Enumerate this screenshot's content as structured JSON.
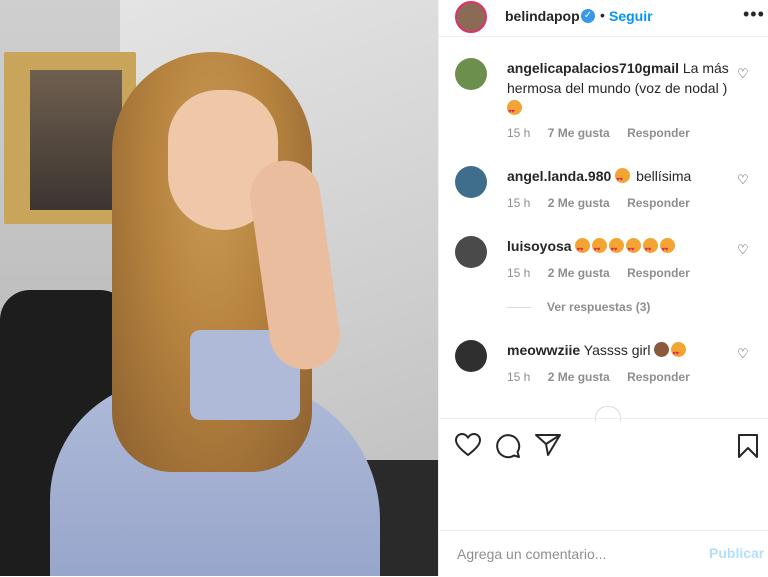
{
  "post": {
    "username": "belindapop",
    "follow_label": "Seguir",
    "dot": "•",
    "more_label": "•••"
  },
  "comments": [
    {
      "username": "angelicapalacios710gmail",
      "text": "La más hermosa del mundo (voz de nodal )",
      "emojis": 1,
      "time": "15 h",
      "likes": "7 Me gusta",
      "reply": "Responder"
    },
    {
      "username": "angel.landa.980",
      "text": "bellísima",
      "emojis": 1,
      "time": "15 h",
      "likes": "2 Me gusta",
      "reply": "Responder"
    },
    {
      "username": "luisoyosa",
      "text": "",
      "emojis": 6,
      "time": "15 h",
      "likes": "2 Me gusta",
      "reply": "Responder"
    },
    {
      "username": "meowwziie",
      "text": "Yassss girl",
      "emojis": 2,
      "time": "15 h",
      "likes": "2 Me gusta",
      "reply": "Responder"
    }
  ],
  "view_replies": "Ver respuestas (3)",
  "add_comment": {
    "placeholder": "Agrega un comentario...",
    "post_label": "Publicar"
  },
  "colors": {
    "accent": "#0095f6",
    "verified": "#3897f0",
    "post_disabled": "#b2dffc"
  }
}
